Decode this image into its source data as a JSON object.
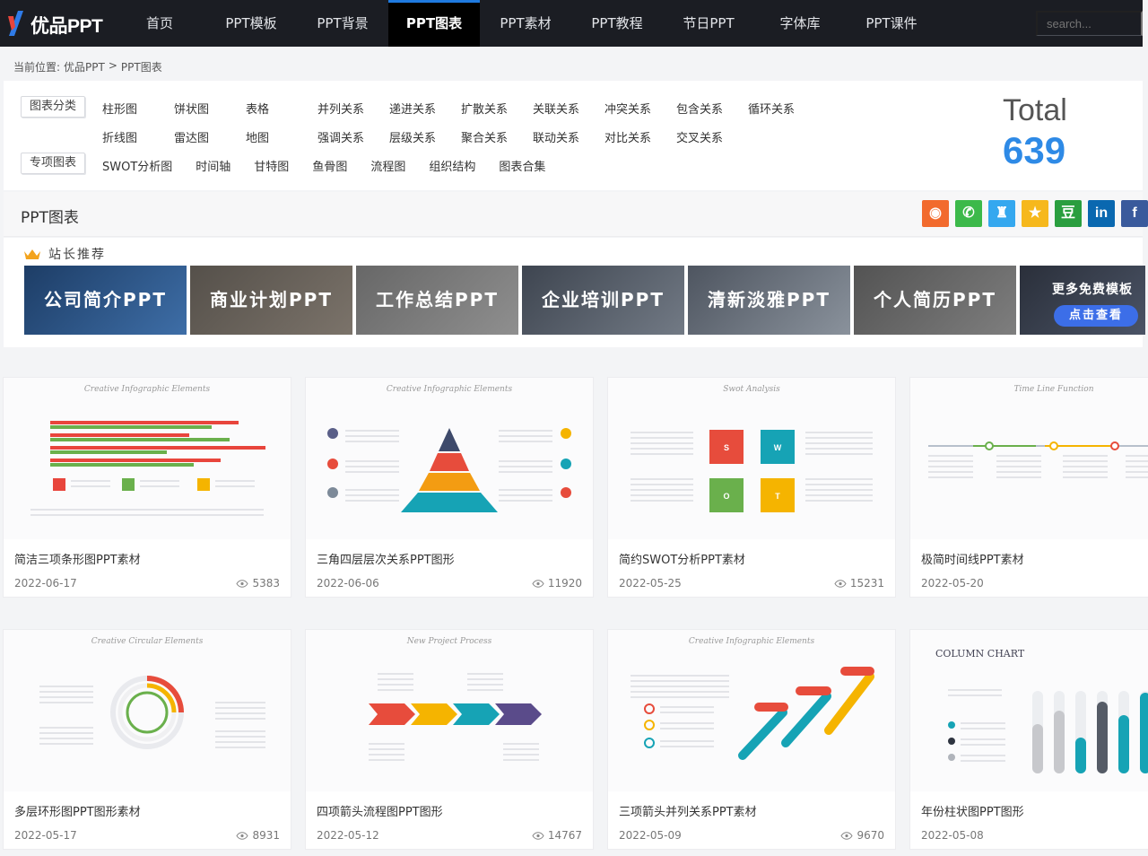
{
  "brand": {
    "logo_text": "优品PPT",
    "accent": "#1f7ae0"
  },
  "nav": {
    "items": [
      "首页",
      "PPT模板",
      "PPT背景",
      "PPT图表",
      "PPT素材",
      "PPT教程",
      "节日PPT",
      "字体库",
      "PPT课件"
    ],
    "active_index": 3,
    "search_placeholder": "search..."
  },
  "breadcrumb": {
    "prefix": "当前位置:",
    "parent": "优品PPT",
    "separator": ">",
    "current": "PPT图表"
  },
  "categories": {
    "chart_label": "图表分类",
    "row1": [
      "柱形图",
      "饼状图",
      "表格",
      "并列关系",
      "递进关系",
      "扩散关系",
      "关联关系",
      "冲突关系",
      "包含关系",
      "循环关系"
    ],
    "row2": [
      "折线图",
      "雷达图",
      "地图",
      "强调关系",
      "层级关系",
      "聚合关系",
      "联动关系",
      "对比关系",
      "交叉关系"
    ],
    "special_label": "专项图表",
    "row3": [
      "SWOT分析图",
      "时间轴",
      "甘特图",
      "鱼骨图",
      "流程图",
      "组织结构",
      "图表合集"
    ],
    "total_label": "Total",
    "total_value": "639"
  },
  "section": {
    "title": "PPT图表"
  },
  "share_icons": [
    {
      "name": "weibo-icon",
      "color": "#f26a2d",
      "glyph": "◉"
    },
    {
      "name": "wechat-icon",
      "color": "#3cb94a",
      "glyph": "✆"
    },
    {
      "name": "qq-icon",
      "color": "#35a8ef",
      "glyph": "♜"
    },
    {
      "name": "qzone-icon",
      "color": "#f6b81c",
      "glyph": "★"
    },
    {
      "name": "douban-icon",
      "color": "#2a9e3f",
      "glyph": "豆"
    },
    {
      "name": "linkedin-icon",
      "color": "#0a68b0",
      "glyph": "in"
    },
    {
      "name": "facebook-icon",
      "color": "#3a5a9c",
      "glyph": "f"
    }
  ],
  "recommend": {
    "title": "站长推荐",
    "cards": [
      "公司简介PPT",
      "商业计划PPT",
      "工作总结PPT",
      "企业培训PPT",
      "清新淡雅PPT",
      "个人简历PPT"
    ],
    "more_text": "更多免费模板",
    "more_button": "点击查看"
  },
  "templates": [
    {
      "title": "简洁三项条形图PPT素材",
      "date": "2022-06-17",
      "views": "5383",
      "thumb_caption": "Creative Infographic Elements"
    },
    {
      "title": "三角四层层次关系PPT图形",
      "date": "2022-06-06",
      "views": "11920",
      "thumb_caption": "Creative Infographic Elements"
    },
    {
      "title": "简约SWOT分析PPT素材",
      "date": "2022-05-25",
      "views": "15231",
      "thumb_caption": "Swot Analysis"
    },
    {
      "title": "极简时间线PPT素材",
      "date": "2022-05-20",
      "views": "",
      "thumb_caption": "Time Line Function"
    },
    {
      "title": "多层环形图PPT图形素材",
      "date": "2022-05-17",
      "views": "8931",
      "thumb_caption": "Creative Circular Elements"
    },
    {
      "title": "四项箭头流程图PPT图形",
      "date": "2022-05-12",
      "views": "14767",
      "thumb_caption": "New Project Process"
    },
    {
      "title": "三项箭头并列关系PPT素材",
      "date": "2022-05-09",
      "views": "9670",
      "thumb_caption": "Creative Infographic Elements"
    },
    {
      "title": "年份柱状图PPT图形",
      "date": "2022-05-08",
      "views": "",
      "thumb_caption": "COLUMN CHART"
    }
  ],
  "swot_letters": [
    "S",
    "W",
    "O",
    "T"
  ]
}
